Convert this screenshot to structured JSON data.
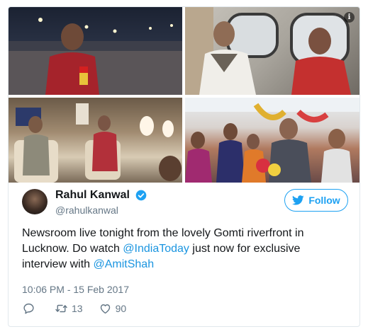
{
  "author": {
    "name": "Rahul Kanwal",
    "handle": "@rahulkanwal"
  },
  "follow_label": "Follow",
  "tweet": {
    "text_before": "Newsroom live tonight from the lovely Gomti riverfront in Lucknow. Do watch ",
    "mention_1": "@IndiaToday",
    "text_middle": " just now for exclusive interview with ",
    "mention_2": "@AmitShah"
  },
  "timestamp": "10:06 PM - 15 Feb 2017",
  "actions": {
    "reply_count": "",
    "retweet_count": "13",
    "like_count": "90"
  },
  "icons": {
    "info": "info-icon",
    "verified": "verified-badge-icon",
    "follow": "twitter-bird-icon",
    "reply": "reply-icon",
    "retweet": "retweet-icon",
    "like": "heart-icon"
  },
  "colors": {
    "accent": "#1da1f2",
    "mention": "#1b95e0",
    "secondary_text": "#657786",
    "border": "#e1e8ed"
  }
}
